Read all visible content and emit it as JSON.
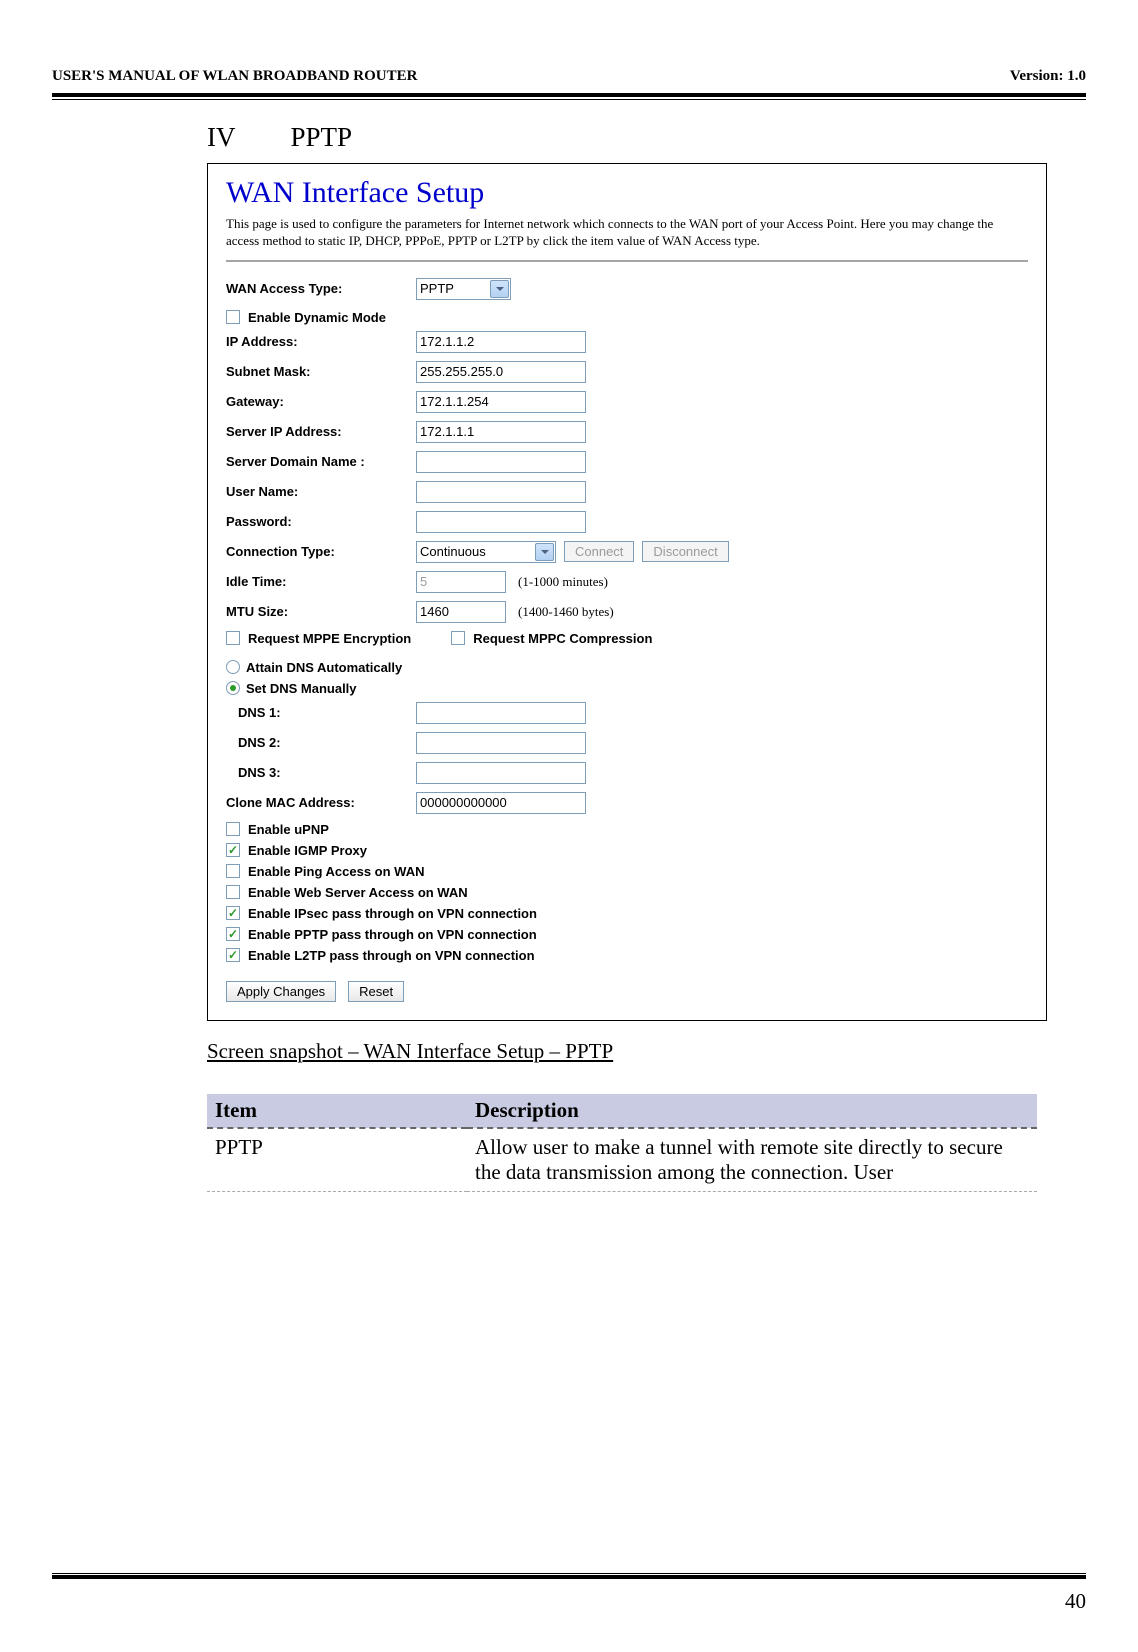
{
  "header": {
    "left": "USER'S MANUAL OF WLAN BROADBAND ROUTER",
    "right": "Version: 1.0"
  },
  "section": {
    "num": "IV",
    "title": "PPTP"
  },
  "panel": {
    "title": "WAN Interface Setup",
    "desc": "This page is used to configure the parameters for Internet network which connects to the WAN port of your Access Point. Here you may change the access method to static IP, DHCP, PPPoE, PPTP or L2TP by click the item value of WAN Access type."
  },
  "form": {
    "wan_access_label": "WAN Access Type:",
    "wan_access_value": "PPTP",
    "enable_dynamic": "Enable Dynamic Mode",
    "ip_label": "IP Address:",
    "ip_value": "172.1.1.2",
    "subnet_label": "Subnet Mask:",
    "subnet_value": "255.255.255.0",
    "gateway_label": "Gateway:",
    "gateway_value": "172.1.1.254",
    "server_ip_label": "Server IP Address:",
    "server_ip_value": "172.1.1.1",
    "server_domain_label": "Server Domain Name :",
    "server_domain_value": "",
    "user_label": "User Name:",
    "user_value": "",
    "pass_label": "Password:",
    "pass_value": "",
    "conn_type_label": "Connection Type:",
    "conn_type_value": "Continuous",
    "connect_btn": "Connect",
    "disconnect_btn": "Disconnect",
    "idle_label": "Idle Time:",
    "idle_value": "5",
    "idle_note": "(1-1000 minutes)",
    "mtu_label": "MTU Size:",
    "mtu_value": "1460",
    "mtu_note": "(1400-1460 bytes)",
    "mppe": "Request MPPE Encryption",
    "mppc": "Request MPPC Compression",
    "attain_dns": "Attain DNS Automatically",
    "set_dns": "Set DNS Manually",
    "dns1_label": "DNS 1:",
    "dns2_label": "DNS 2:",
    "dns3_label": "DNS 3:",
    "clone_label": "Clone MAC Address:",
    "clone_value": "000000000000",
    "upnp": "Enable uPNP",
    "igmp": "Enable IGMP Proxy",
    "ping": "Enable Ping Access on WAN",
    "webserver": "Enable Web Server Access on WAN",
    "ipsec": "Enable IPsec pass through on VPN connection",
    "pptp_pass": "Enable PPTP pass through on VPN connection",
    "l2tp_pass": "Enable L2TP pass through on VPN connection",
    "apply": "Apply Changes",
    "reset": "Reset"
  },
  "caption": "Screen snapshot – WAN Interface Setup – PPTP",
  "table": {
    "h1": "Item",
    "h2": "Description",
    "r1c1": "PPTP",
    "r1c2": "Allow user to make a tunnel with remote site directly to secure the data transmission among the connection. User"
  },
  "page_number": "40"
}
